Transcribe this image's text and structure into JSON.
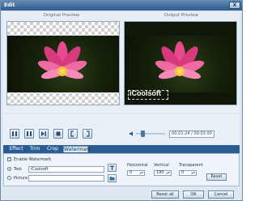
{
  "window": {
    "title": "Edit",
    "close_label": "X"
  },
  "preview": {
    "original_title": "Original Preview",
    "output_title": "Output Preview",
    "watermark_text": "iCoolsoft",
    "progress": 0.52
  },
  "player": {
    "time_display": "00:01:24 / 00:03:00",
    "volume_level": 0.2,
    "buttons": [
      "play",
      "pause",
      "next-frame",
      "stop",
      "start-mark",
      "end-mark"
    ]
  },
  "tabs": [
    {
      "label": "Effect",
      "active": false
    },
    {
      "label": "Trim",
      "active": false
    },
    {
      "label": "Crop",
      "active": false
    },
    {
      "label": "Watermark",
      "active": true
    }
  ],
  "watermark": {
    "enable_label": "Enable Watermark",
    "text_label": "Text",
    "text_value": "iCoolsoft",
    "picture_label": "Picture",
    "horizontal_label": "Horizontal",
    "horizontal_value": "0",
    "vertical_label": "Vertical",
    "vertical_value": "190",
    "transparent_label": "Transparent",
    "transparent_value": "0",
    "reset_label": "Reset"
  },
  "footer": {
    "reset_all": "Reset all",
    "ok": "OK",
    "cancel": "Cancel"
  },
  "colors": {
    "title_bar": "#2f5d8e",
    "tab_bar": "#2a5d93",
    "accent_blue": "#2f63c9"
  }
}
